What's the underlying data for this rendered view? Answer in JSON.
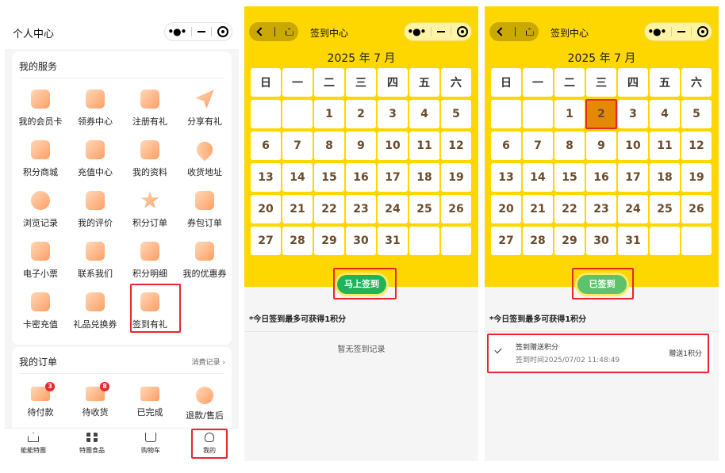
{
  "profile": {
    "title": "个人中心",
    "services_title": "我的服务",
    "services": [
      {
        "label": "我的会员卡",
        "icon": "crown-icon"
      },
      {
        "label": "领券中心",
        "icon": "coupon-icon"
      },
      {
        "label": "注册有礼",
        "icon": "gift-icon"
      },
      {
        "label": "分享有礼",
        "icon": "paper-plane-icon"
      },
      {
        "label": "积分商城",
        "icon": "shop-icon"
      },
      {
        "label": "充值中心",
        "icon": "recharge-icon"
      },
      {
        "label": "我的资料",
        "icon": "document-icon"
      },
      {
        "label": "收货地址",
        "icon": "location-pin-icon"
      },
      {
        "label": "浏览记录",
        "icon": "footprint-icon"
      },
      {
        "label": "我的评价",
        "icon": "comment-icon"
      },
      {
        "label": "积分订单",
        "icon": "star-icon"
      },
      {
        "label": "券包订单",
        "icon": "ticket-icon"
      },
      {
        "label": "电子小票",
        "icon": "receipt-icon"
      },
      {
        "label": "联系我们",
        "icon": "phone-icon"
      },
      {
        "label": "积分明细",
        "icon": "points-detail-icon"
      },
      {
        "label": "我的优惠券",
        "icon": "voucher-icon"
      },
      {
        "label": "卡密充值",
        "icon": "card-icon"
      },
      {
        "label": "礼品兑换券",
        "icon": "gift-voucher-icon"
      },
      {
        "label": "签到有礼",
        "icon": "calendar-check-icon"
      }
    ],
    "orders_title": "我的订单",
    "orders_more": "消费记录 ›",
    "orders": [
      {
        "label": "待付款",
        "icon": "wallet-icon",
        "badge": "3"
      },
      {
        "label": "待收货",
        "icon": "truck-icon",
        "badge": "8"
      },
      {
        "label": "已完成",
        "icon": "box-icon",
        "badge": ""
      },
      {
        "label": "退款/售后",
        "icon": "refund-icon",
        "badge": ""
      }
    ],
    "tabs": [
      {
        "label": "能能特團",
        "icon": "home-icon"
      },
      {
        "label": "特團食品",
        "icon": "category-icon"
      },
      {
        "label": "购物车",
        "icon": "cart-icon"
      },
      {
        "label": "我的",
        "icon": "user-icon"
      }
    ]
  },
  "checkin_before": {
    "nav_title": "签到中心",
    "month_title": "2025 年 7 月",
    "button_label": "马上签到",
    "tip": "*今日签到最多可获得1积分",
    "empty_text": "暂无签到记录"
  },
  "checkin_after": {
    "nav_title": "签到中心",
    "month_title": "2025 年 7 月",
    "button_label": "已签到",
    "tip": "*今日签到最多可获得1积分",
    "record_title": "签到赠送积分",
    "record_time": "签到时间2025/07/02 11:48:49",
    "record_points": "赠送1积分",
    "checked_day": "2"
  },
  "calendar": {
    "weekdays": [
      "日",
      "一",
      "二",
      "三",
      "四",
      "五",
      "六"
    ],
    "weeks": [
      [
        "",
        "",
        "1",
        "2",
        "3",
        "4",
        "5"
      ],
      [
        "6",
        "7",
        "8",
        "9",
        "10",
        "11",
        "12"
      ],
      [
        "13",
        "14",
        "15",
        "16",
        "17",
        "18",
        "19"
      ],
      [
        "20",
        "21",
        "22",
        "23",
        "24",
        "25",
        "26"
      ],
      [
        "27",
        "28",
        "29",
        "30",
        "31",
        "",
        ""
      ]
    ]
  },
  "colors": {
    "brand_yellow": "#ffd700",
    "checked_orange": "#e58a00",
    "button_green": "#21b35a",
    "highlight_red": "#e8262c"
  }
}
